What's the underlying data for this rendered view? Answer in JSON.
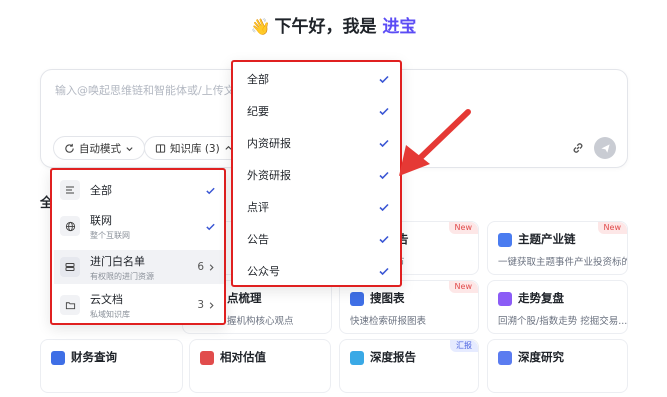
{
  "greeting": {
    "emoji": "👋",
    "prefix": "下午好，我是 ",
    "name": "进宝"
  },
  "input": {
    "placeholder": "输入@唤起思维链和智能体或/上传文"
  },
  "toolbar": {
    "mode_label": "自动模式",
    "kb_label": "知识库 (3)"
  },
  "section": {
    "title": "全"
  },
  "kb_menu": {
    "items": [
      {
        "label": "全部",
        "sub": "",
        "right": "",
        "checked": true
      },
      {
        "label": "联网",
        "sub": "整个互联网",
        "right": "",
        "checked": true
      },
      {
        "label": "进门白名单",
        "sub": "有权限的进门资源",
        "right": "6",
        "checked": false
      },
      {
        "label": "云文档",
        "sub": "私域知识库",
        "right": "3",
        "checked": false
      }
    ]
  },
  "filter_menu": {
    "items": [
      {
        "label": "全部"
      },
      {
        "label": "纪要"
      },
      {
        "label": "内资研报"
      },
      {
        "label": "外资研报"
      },
      {
        "label": "点评"
      },
      {
        "label": "公告"
      },
      {
        "label": "公众号"
      }
    ]
  },
  "tiles": [
    {
      "title": "主题产业链",
      "desc": "一键获取主题事件产业投资标的",
      "badge": "New"
    },
    {
      "title": "搜图表",
      "desc": "快速检索研报图表",
      "badge": "New"
    },
    {
      "title": "走势复盘",
      "desc": "回溯个股/指数走势 挖掘交易...",
      "badge": ""
    },
    {
      "title": "财务查询",
      "desc": "",
      "badge": ""
    },
    {
      "title": "相对估值",
      "desc": "",
      "badge": ""
    },
    {
      "title": "深度报告",
      "desc": "",
      "badge": "汇报"
    },
    {
      "title": "深度研究",
      "desc": "",
      "badge": ""
    }
  ],
  "partial": {
    "tile1_badge": "New",
    "tile1_desc_tail": "节",
    "tile1_title_tail": "告",
    "tile2_title_tail": "点梳理",
    "tile2_desc_tail": "握机构核心观点"
  },
  "colors": {
    "accent": "#5b4cf5",
    "check": "#3a56d4",
    "highlight_border": "#e02020"
  }
}
